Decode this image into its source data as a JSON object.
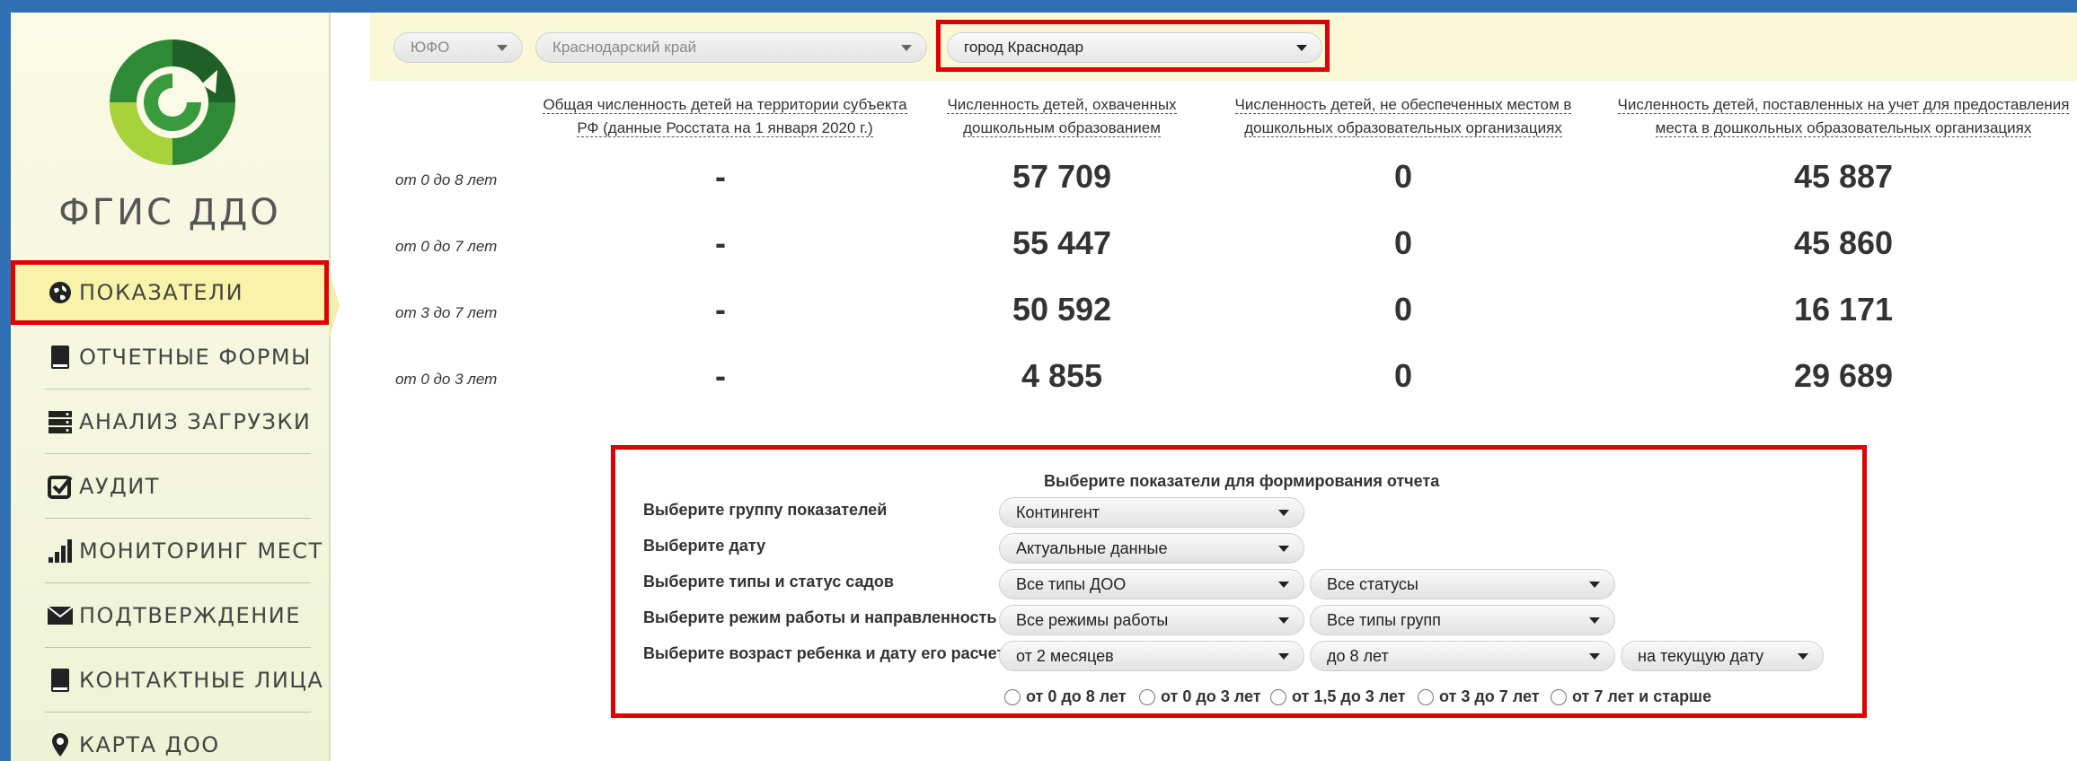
{
  "colors": {
    "accent_red": "#e10000",
    "sidebar_bg": "#f4f5dc",
    "frame_blue": "#2f6fb3"
  },
  "brand": {
    "name": "ФГИС ДДО"
  },
  "nav": [
    {
      "label": "ПОКАЗАТЕЛИ",
      "icon": "globe-icon",
      "active": true
    },
    {
      "label": "ОТЧЕТНЫЕ ФОРМЫ",
      "icon": "book-icon"
    },
    {
      "label": "АНАЛИЗ ЗАГРУЗКИ",
      "icon": "server-icon"
    },
    {
      "label": "АУДИТ",
      "icon": "check-square-icon"
    },
    {
      "label": "МОНИТОРИНГ МЕСТ",
      "icon": "signal-bars-icon"
    },
    {
      "label": "ПОДТВЕРЖДЕНИЕ",
      "icon": "envelope-icon"
    },
    {
      "label": "КОНТАКТНЫЕ ЛИЦА",
      "icon": "book-icon"
    },
    {
      "label": "КАРТА ДОО",
      "icon": "map-marker-icon"
    }
  ],
  "filters": {
    "district": "ЮФО",
    "region": "Краснодарский край",
    "city": "город Краснодар"
  },
  "stats": {
    "columns": [
      "Общая численность детей на территории субъекта РФ (данные Росстата на 1 января 2020 г.)",
      "Численность детей, охваченных дошкольным образованием",
      "Численность детей, не обеспеченных местом в дошкольных образовательных организациях",
      "Численность детей, поставленных на учет для предоставления места в дошкольных образовательных организациях"
    ],
    "col1_line1": "Общая численность детей на территории субъекта",
    "col1_line2": "РФ (данные Росстата на 1 января 2020 г.)",
    "col2_line1": "Численность детей, охваченных",
    "col2_line2": "дошкольным образованием",
    "col3_line1": "Численность детей, не обеспеченных местом в",
    "col3_line2": "дошкольных образовательных организациях",
    "col4_line1": "Численность детей, поставленных на учет для предоставления",
    "col4_line2": "места в дошкольных образовательных организациях",
    "rows": [
      {
        "label": "от 0 до 8 лет",
        "values": [
          "-",
          "57 709",
          "0",
          "45 887"
        ]
      },
      {
        "label": "от 0 до 7 лет",
        "values": [
          "-",
          "55 447",
          "0",
          "45 860"
        ]
      },
      {
        "label": "от 3 до 7 лет",
        "values": [
          "-",
          "50 592",
          "0",
          "16 171"
        ]
      },
      {
        "label": "от 0 до 3 лет",
        "values": [
          "-",
          "4 855",
          "0",
          "29 689"
        ]
      }
    ]
  },
  "report": {
    "title": "Выберите показатели для формирования отчета",
    "group_label": "Выберите группу показателей",
    "group_value": "Контингент",
    "date_label": "Выберите дату",
    "date_value": "Актуальные данные",
    "type_label": "Выберите типы и статус садов",
    "type_value": "Все типы ДОО",
    "status_value": "Все статусы",
    "mode_label": "Выберите режим работы и направленность",
    "mode_value": "Все режимы работы",
    "groups_value": "Все типы групп",
    "age_label": "Выберите возраст ребенка и дату его расчета",
    "age_from": "от 2 месяцев",
    "age_to": "до 8 лет",
    "age_date": "на текущую дату",
    "radios": [
      "от 0 до 8 лет",
      "от 0 до 3 лет",
      "от 1,5 до 3 лет",
      "от 3 до 7 лет",
      "от 7 лет и старше"
    ]
  }
}
